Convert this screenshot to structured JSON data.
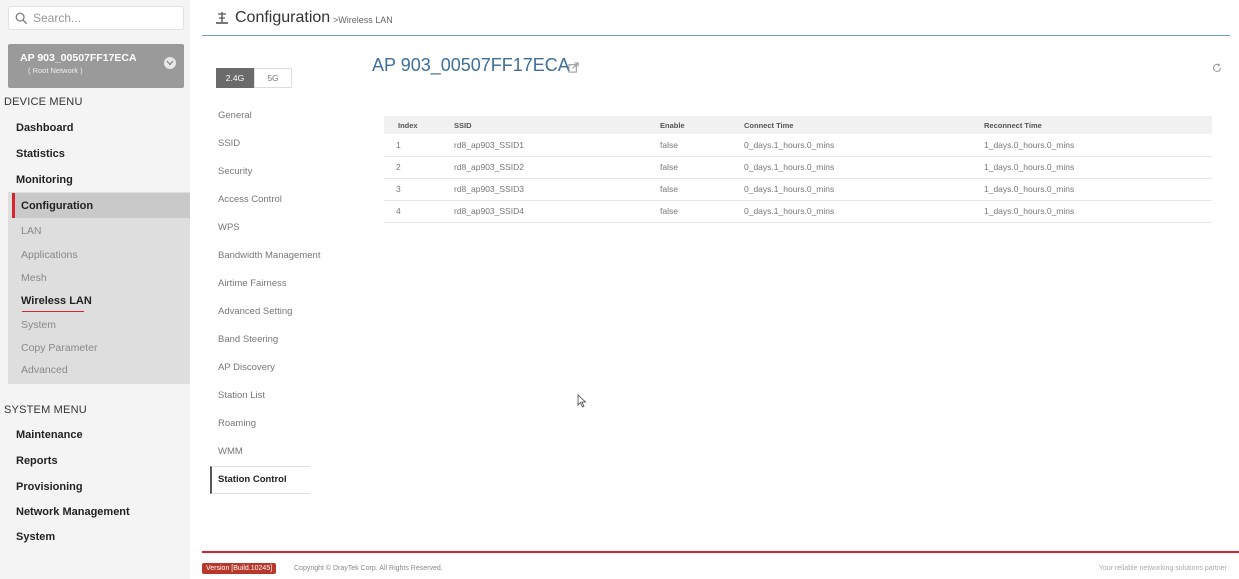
{
  "search": {
    "placeholder": "Search..."
  },
  "device": {
    "name": "AP 903_00507FF17ECA",
    "network": "( Root Network )"
  },
  "device_menu": {
    "heading": "DEVICE MENU",
    "items": [
      "Dashboard",
      "Statistics",
      "Monitoring",
      "Configuration"
    ],
    "config_sub": [
      "LAN",
      "Applications",
      "Mesh",
      "Wireless LAN",
      "System",
      "Copy Parameter",
      "Advanced"
    ]
  },
  "system_menu": {
    "heading": "SYSTEM MENU",
    "items": [
      "Maintenance",
      "Reports",
      "Provisioning",
      "Network Management",
      "System"
    ]
  },
  "header": {
    "title": "Configuration",
    "breadcrumb": ">Wireless LAN"
  },
  "band_tabs": {
    "active": "2.4G",
    "other": "5G"
  },
  "wlan_nav": [
    "General",
    "SSID",
    "Security",
    "Access Control",
    "WPS",
    "Bandwidth Management",
    "Airtime Fairness",
    "Advanced Setting",
    "Band Steering",
    "AP Discovery",
    "Station List",
    "Roaming",
    "WMM",
    "Station Control"
  ],
  "main": {
    "title": "AP 903_00507FF17ECA"
  },
  "table": {
    "headers": [
      "Index",
      "SSID",
      "Enable",
      "Connect Time",
      "Reconnect Time"
    ],
    "rows": [
      [
        "1",
        "rd8_ap903_SSID1",
        "false",
        "0_days.1_hours.0_mins",
        "1_days.0_hours.0_mins"
      ],
      [
        "2",
        "rd8_ap903_SSID2",
        "false",
        "0_days.1_hours.0_mins",
        "1_days.0_hours.0_mins"
      ],
      [
        "3",
        "rd8_ap903_SSID3",
        "false",
        "0_days.1_hours.0_mins",
        "1_days.0_hours.0_mins"
      ],
      [
        "4",
        "rd8_ap903_SSID4",
        "false",
        "0_days.1_hours.0_mins",
        "1_days.0_hours.0_mins"
      ]
    ]
  },
  "footer": {
    "version": "Version [Build.10245]",
    "copyright": "Copyright © DrayTek Corp. All Rights Reserved.",
    "tagline": "Your reliable networking solutions partner"
  },
  "icons": {
    "search": "search-icon",
    "chevron": "chevron-down-icon",
    "config": "configuration-icon",
    "external": "external-link-icon",
    "refresh": "refresh-icon"
  },
  "colors": {
    "accent": "#d9232e",
    "title_blue": "#3d6e9c"
  }
}
